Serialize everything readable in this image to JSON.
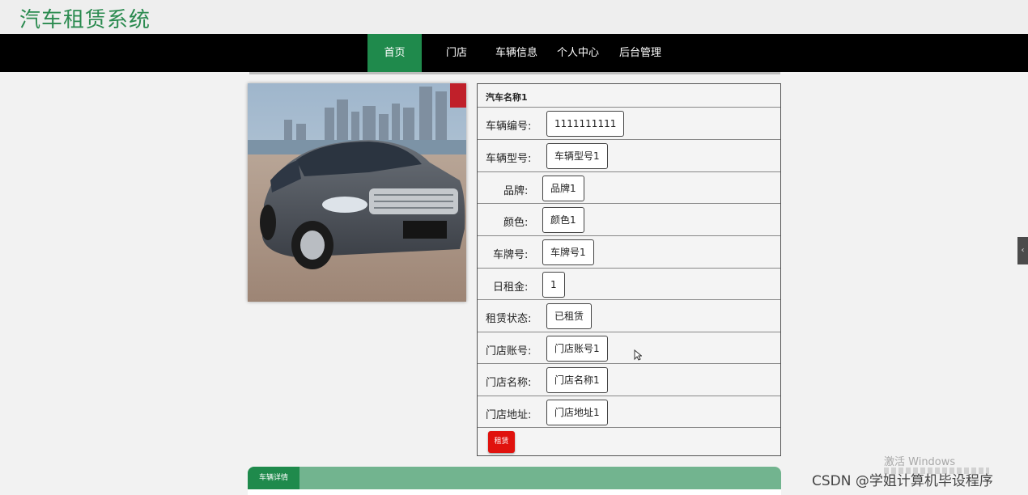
{
  "header": {
    "site_title": "汽车租赁系统"
  },
  "nav": {
    "items": [
      {
        "label": "首页",
        "active": true
      },
      {
        "label": "门店",
        "active": false
      },
      {
        "label": "车辆信息",
        "active": false
      },
      {
        "label": "个人中心",
        "active": false
      },
      {
        "label": "后台管理",
        "active": false
      }
    ]
  },
  "car": {
    "name": "汽车名称1",
    "fields": [
      {
        "label": "车辆编号:",
        "value": "1111111111"
      },
      {
        "label": "车辆型号:",
        "value": "车辆型号1"
      },
      {
        "label": "品牌:",
        "value": "品牌1"
      },
      {
        "label": "颜色:",
        "value": "颜色1"
      },
      {
        "label": "车牌号:",
        "value": "车牌号1"
      },
      {
        "label": "日租金:",
        "value": "1"
      },
      {
        "label": "租赁状态:",
        "value": "已租赁"
      },
      {
        "label": "门店账号:",
        "value": "门店账号1"
      },
      {
        "label": "门店名称:",
        "value": "门店名称1"
      },
      {
        "label": "门店地址:",
        "value": "门店地址1"
      }
    ],
    "rent_button": "租赁"
  },
  "detail_tab": {
    "label": "车辆详情"
  },
  "watermarks": {
    "windows_activate": "激活 Windows",
    "csdn": "CSDN @学姐计算机毕设程序"
  },
  "colors": {
    "brand_green": "#1f8a4c",
    "title_green": "#2a8a4f",
    "nav_bg": "#000000",
    "rent_red": "#e0120e"
  }
}
